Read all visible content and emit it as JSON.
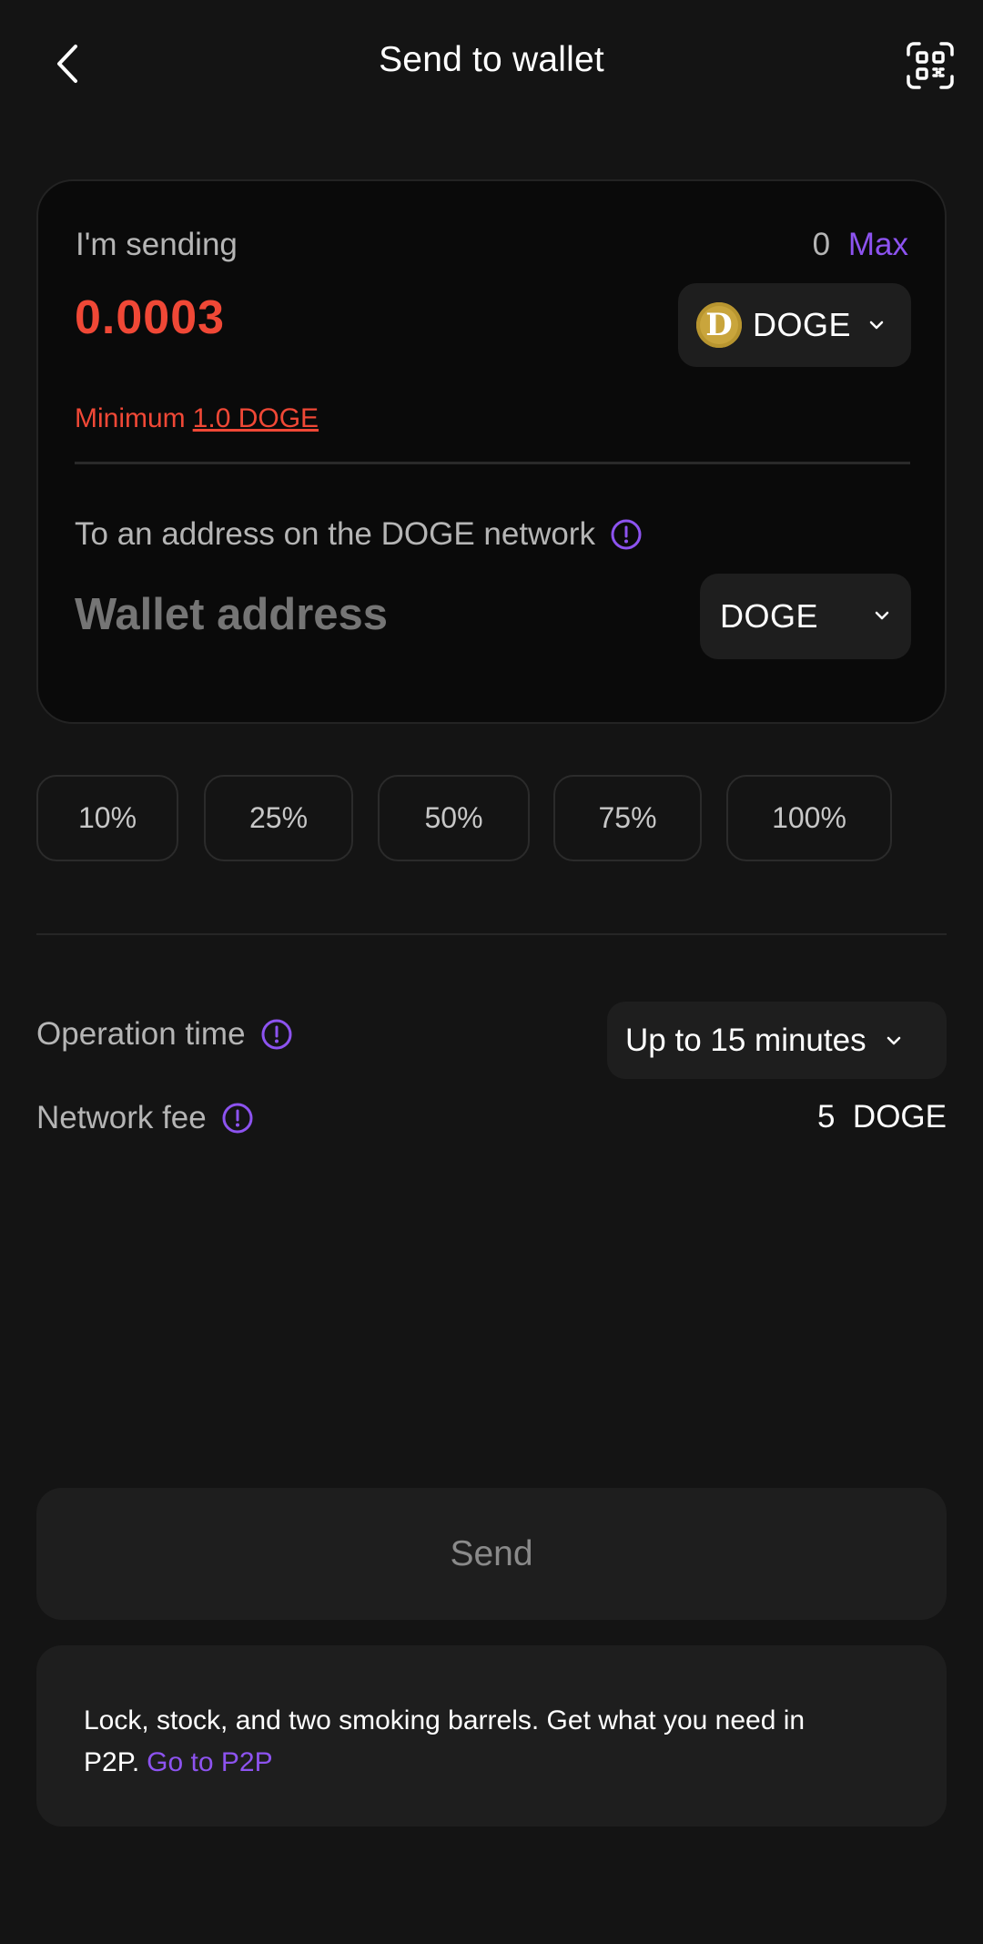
{
  "header": {
    "title": "Send to wallet"
  },
  "card": {
    "sending_label": "I'm sending",
    "balance_value": "0",
    "max_label": "Max",
    "amount": "0.0003",
    "coin": "DOGE",
    "minimum_prefix": "Minimum",
    "minimum_value": "1.0 DOGE",
    "network_label": "To an address on the DOGE network",
    "wallet_placeholder": "Wallet address",
    "network": "DOGE"
  },
  "percent_chips": [
    "10%",
    "25%",
    "50%",
    "75%",
    "100%"
  ],
  "details": {
    "operation_time_label": "Operation time",
    "operation_time_value": "Up to 15 minutes",
    "network_fee_label": "Network fee",
    "network_fee_value": "5  DOGE"
  },
  "send_button": "Send",
  "promo": {
    "text": "Lock, stock, and two smoking barrels. Get what you need in P2P.",
    "link": "Go to P2P"
  },
  "colors": {
    "background": "#141414",
    "card_background": "#0a0a0a",
    "accent_purple": "#8d53f0",
    "error_red": "#f04836",
    "doge_gold": "#c9a53c"
  },
  "icons": {
    "back": "back-arrow-icon",
    "scan": "qr-scan-icon",
    "coin": "doge-coin-icon",
    "chevron": "chevron-down-icon",
    "info": "info-icon"
  }
}
